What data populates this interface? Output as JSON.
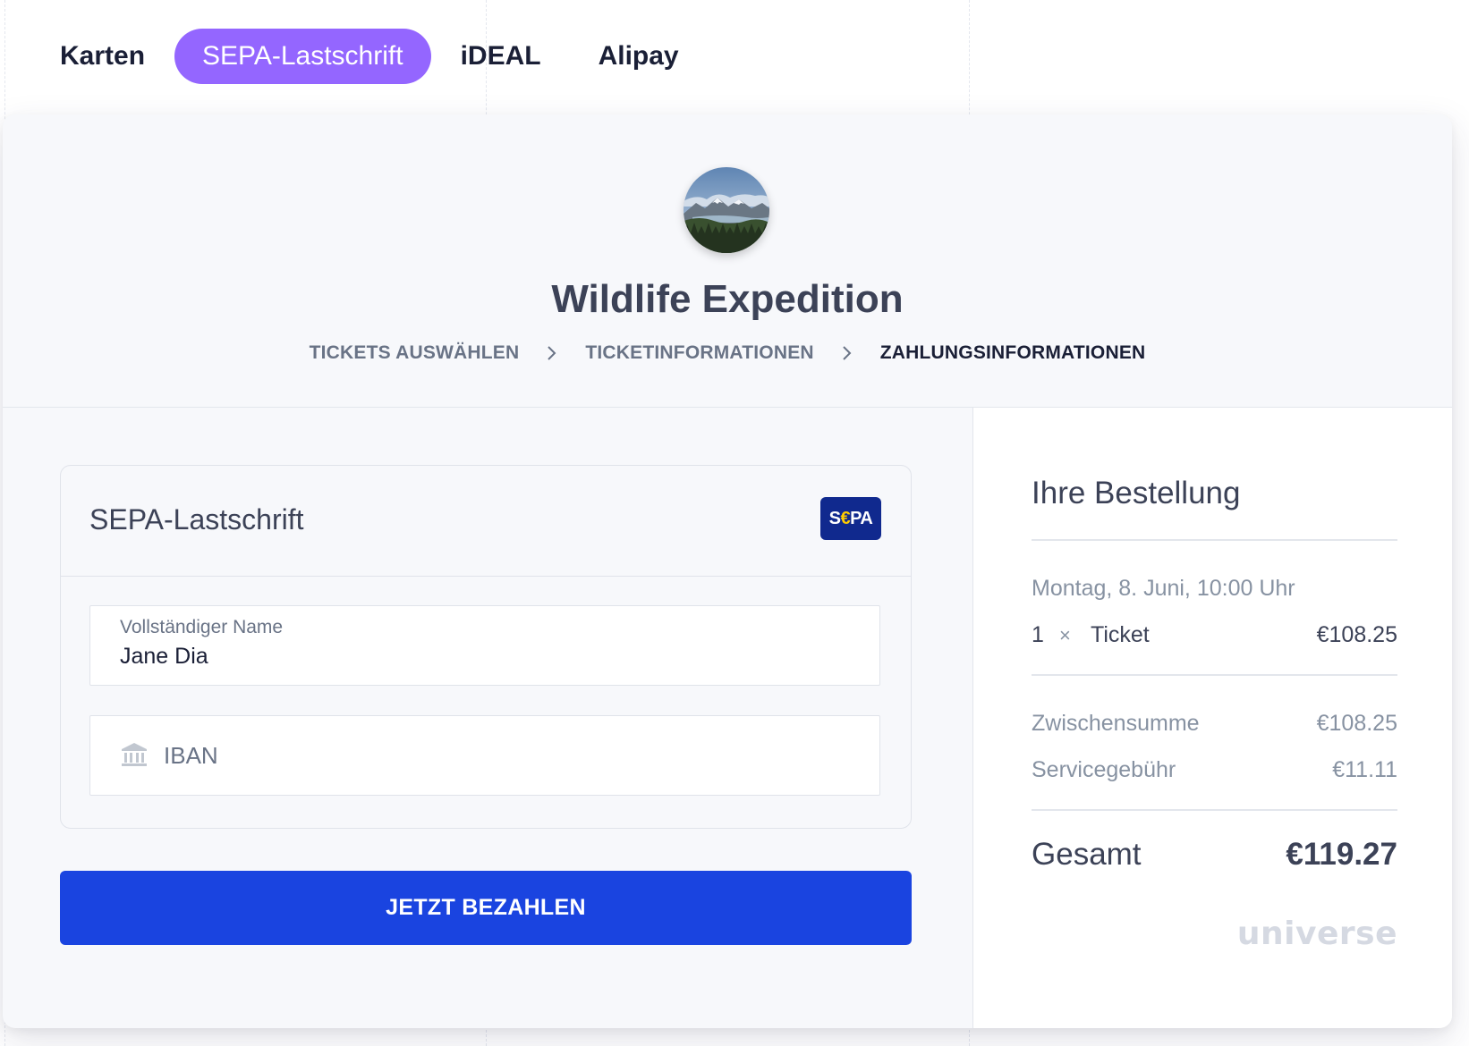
{
  "tabs": [
    {
      "label": "Karten",
      "active": false
    },
    {
      "label": "SEPA-Lastschrift",
      "active": true
    },
    {
      "label": "iDEAL",
      "active": false
    },
    {
      "label": "Alipay",
      "active": false
    }
  ],
  "event": {
    "title": "Wildlife Expedition",
    "avatar_icon": "mountain-landscape-photo"
  },
  "breadcrumb": [
    {
      "label": "TICKETS AUSWÄHLEN",
      "current": false
    },
    {
      "label": "TICKETINFORMATIONEN",
      "current": false
    },
    {
      "label": "ZAHLUNGSINFORMATIONEN",
      "current": true
    }
  ],
  "payment": {
    "method_title": "SEPA-Lastschrift",
    "logo": {
      "s": "S",
      "euro": "€",
      "pa": "PA"
    },
    "name_field": {
      "label": "Vollständiger Name",
      "value": "Jane Dia"
    },
    "iban_field": {
      "placeholder": "IBAN",
      "icon": "bank-icon"
    },
    "pay_button": "JETZT BEZAHLEN"
  },
  "order": {
    "title": "Ihre Bestellung",
    "date": "Montag, 8. Juni, 10:00 Uhr",
    "line": {
      "qty": "1",
      "times": "×",
      "name": "Ticket",
      "price": "€108.25"
    },
    "subtotal": {
      "label": "Zwischensumme",
      "amount": "€108.25"
    },
    "fee": {
      "label": "Servicegebühr",
      "amount": "€11.11"
    },
    "total": {
      "label": "Gesamt",
      "amount": "€119.27"
    },
    "brand": "universe"
  },
  "colors": {
    "accent_tab": "#9466ff",
    "pay_button": "#1a44e0",
    "sepa_logo_bg": "#10298e",
    "sepa_logo_euro": "#ffcc00"
  }
}
